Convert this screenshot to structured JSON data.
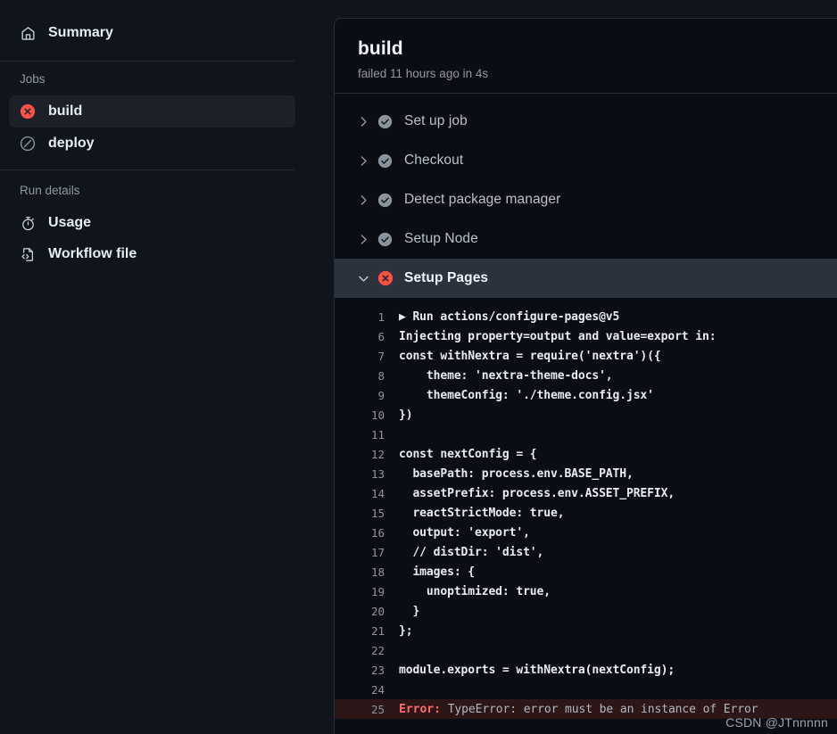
{
  "sidebar": {
    "summary": {
      "label": "Summary",
      "icon": "home-icon"
    },
    "jobs_title": "Jobs",
    "jobs": [
      {
        "label": "build",
        "icon": "failure-icon",
        "selected": true
      },
      {
        "label": "deploy",
        "icon": "skipped-icon",
        "selected": false
      }
    ],
    "run_details_title": "Run details",
    "run_details": [
      {
        "label": "Usage",
        "icon": "stopwatch-icon"
      },
      {
        "label": "Workflow file",
        "icon": "workflow-file-icon"
      }
    ]
  },
  "main": {
    "job_title": "build",
    "job_subtitle": "failed 11 hours ago in 4s",
    "steps": [
      {
        "label": "Set up job",
        "status": "success",
        "expanded": false
      },
      {
        "label": "Checkout",
        "status": "success",
        "expanded": false
      },
      {
        "label": "Detect package manager",
        "status": "success",
        "expanded": false
      },
      {
        "label": "Setup Node",
        "status": "success",
        "expanded": false
      },
      {
        "label": "Setup Pages",
        "status": "failure",
        "expanded": true
      }
    ],
    "log_lines": [
      {
        "n": "1",
        "text": "▶ Run actions/configure-pages@v5"
      },
      {
        "n": "6",
        "text": "Injecting property=output and value=export in:"
      },
      {
        "n": "7",
        "text": "const withNextra = require('nextra')({"
      },
      {
        "n": "8",
        "text": "    theme: 'nextra-theme-docs',"
      },
      {
        "n": "9",
        "text": "    themeConfig: './theme.config.jsx'"
      },
      {
        "n": "10",
        "text": "})"
      },
      {
        "n": "11",
        "text": ""
      },
      {
        "n": "12",
        "text": "const nextConfig = {"
      },
      {
        "n": "13",
        "text": "  basePath: process.env.BASE_PATH,"
      },
      {
        "n": "14",
        "text": "  assetPrefix: process.env.ASSET_PREFIX,"
      },
      {
        "n": "15",
        "text": "  reactStrictMode: true,"
      },
      {
        "n": "16",
        "text": "  output: 'export',"
      },
      {
        "n": "17",
        "text": "  // distDir: 'dist',"
      },
      {
        "n": "18",
        "text": "  images: {"
      },
      {
        "n": "19",
        "text": "    unoptimized: true,"
      },
      {
        "n": "20",
        "text": "  }"
      },
      {
        "n": "21",
        "text": "};"
      },
      {
        "n": "22",
        "text": ""
      },
      {
        "n": "23",
        "text": "module.exports = withNextra(nextConfig);"
      },
      {
        "n": "24",
        "text": ""
      }
    ],
    "error_line": {
      "n": "25",
      "tag": "Error:",
      "text": " TypeError: error must be an instance of Error"
    }
  },
  "watermark": "CSDN @JTnnnnn",
  "colors": {
    "page_bg": "#10141c",
    "panel_bg": "#0a0e14",
    "failure_red": "#f85149",
    "error_row_bg": "#2c1618",
    "selected_row_bg": "#2b323c",
    "muted_text": "#9198a1"
  }
}
